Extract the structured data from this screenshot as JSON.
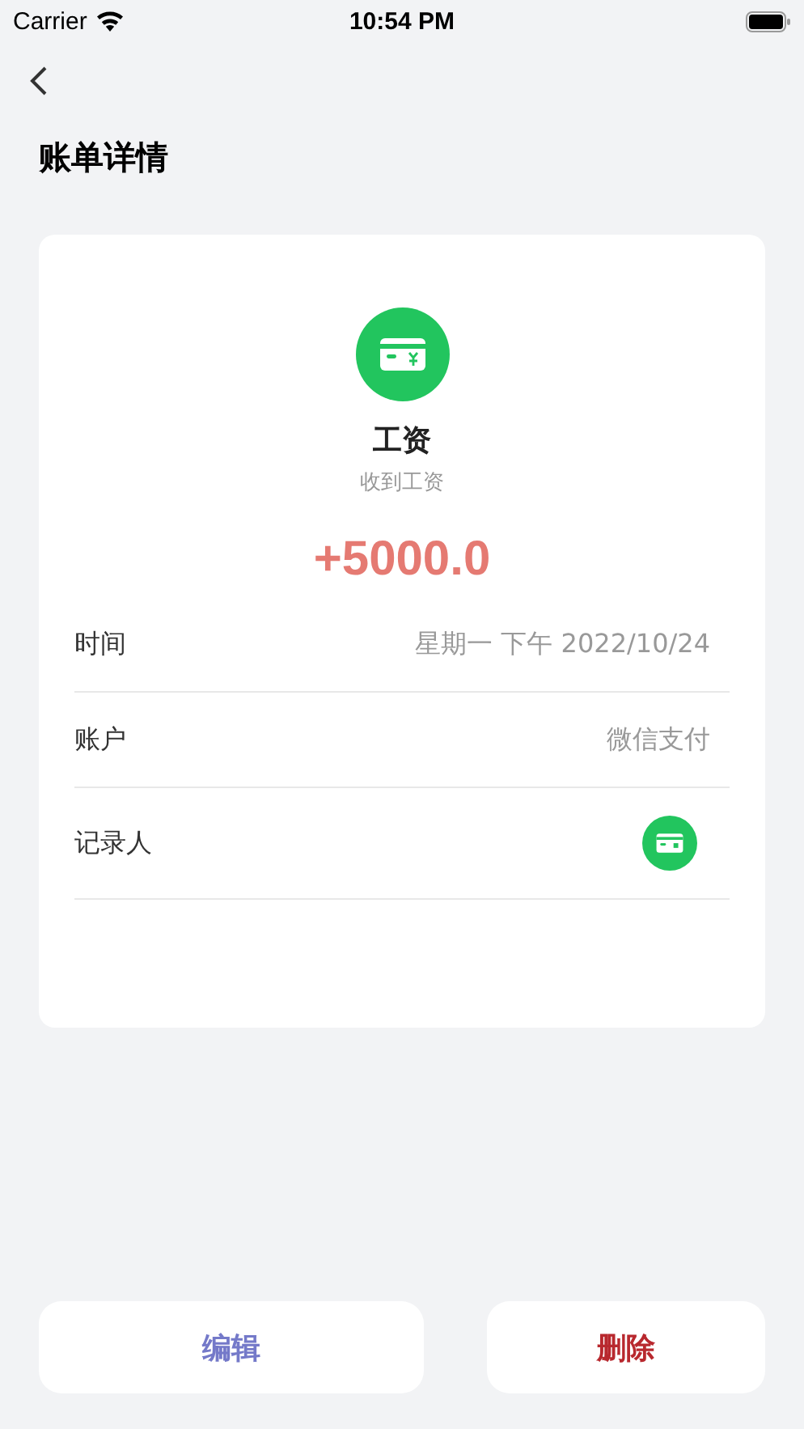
{
  "status_bar": {
    "carrier": "Carrier",
    "time": "10:54 PM"
  },
  "title": "账单详情",
  "bill": {
    "category": "工资",
    "note": "收到工资",
    "amount": "+5000.0",
    "rows": [
      {
        "kind": "text",
        "label": "时间",
        "value": "星期一 下午 2022/10/24"
      },
      {
        "kind": "text",
        "label": "账户",
        "value": "微信支付"
      },
      {
        "kind": "icon",
        "label": "记录人"
      }
    ]
  },
  "buttons": [
    {
      "kind": "edit",
      "label": "编辑"
    },
    {
      "kind": "delete",
      "label": "删除"
    }
  ]
}
